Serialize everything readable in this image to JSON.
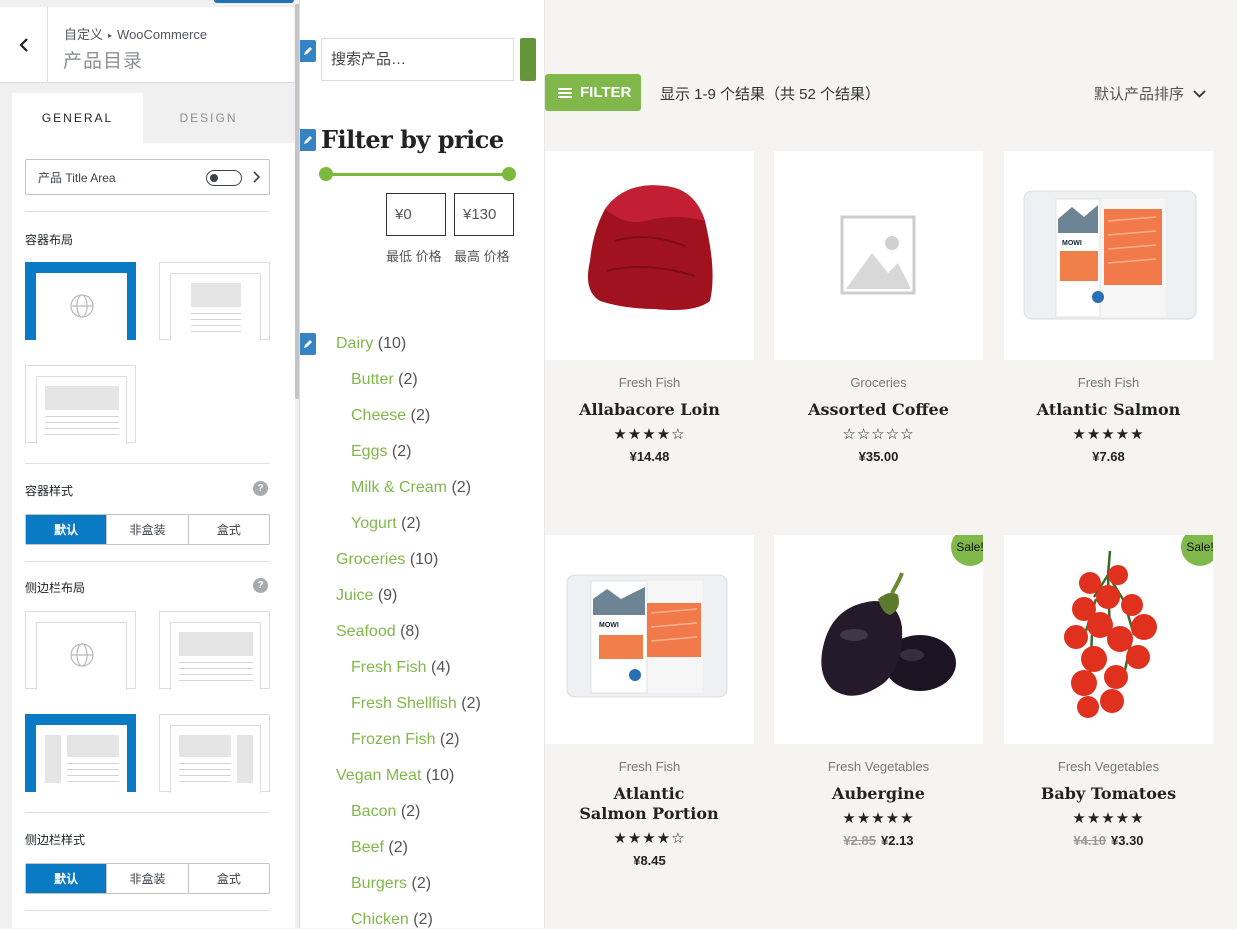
{
  "customizer": {
    "breadcrumb_root": "自定义",
    "breadcrumb_section": "WooCommerce",
    "title": "产品目录",
    "tabs": [
      "GENERAL",
      "DESIGN"
    ],
    "title_area_label": "产品 Title Area",
    "title_area_enabled": false,
    "container_layout_label": "容器布局",
    "container_style_label": "容器样式",
    "sidebar_layout_label": "侧边栏布局",
    "sidebar_style_label": "侧边栏样式",
    "help_icon": "?",
    "style_options": [
      "默认",
      "非盒装",
      "盒式"
    ],
    "container_style_selected": "默认",
    "sidebar_style_selected": "默认",
    "accent_color": "#0a7ac5"
  },
  "sidebar": {
    "search_placeholder": "搜索产品…",
    "filter_title": "Filter by price",
    "min_price": "¥0",
    "max_price": "¥130",
    "min_label": "最低 价格",
    "max_label": "最高 价格",
    "categories": [
      {
        "name": "Dairy",
        "count": "(10)",
        "level": 0
      },
      {
        "name": "Butter",
        "count": "(2)",
        "level": 1
      },
      {
        "name": "Cheese",
        "count": "(2)",
        "level": 1
      },
      {
        "name": "Eggs",
        "count": "(2)",
        "level": 1
      },
      {
        "name": "Milk & Cream",
        "count": "(2)",
        "level": 1
      },
      {
        "name": "Yogurt",
        "count": "(2)",
        "level": 1
      },
      {
        "name": "Groceries",
        "count": "(10)",
        "level": 0
      },
      {
        "name": "Juice",
        "count": "(9)",
        "level": 0
      },
      {
        "name": "Seafood",
        "count": "(8)",
        "level": 0
      },
      {
        "name": "Fresh Fish",
        "count": "(4)",
        "level": 1
      },
      {
        "name": "Fresh Shellfish",
        "count": "(2)",
        "level": 1
      },
      {
        "name": "Frozen Fish",
        "count": "(2)",
        "level": 1
      },
      {
        "name": "Vegan Meat",
        "count": "(10)",
        "level": 0
      },
      {
        "name": "Bacon",
        "count": "(2)",
        "level": 1
      },
      {
        "name": "Beef",
        "count": "(2)",
        "level": 1
      },
      {
        "name": "Burgers",
        "count": "(2)",
        "level": 1
      },
      {
        "name": "Chicken",
        "count": "(2)",
        "level": 1
      }
    ],
    "link_color": "#81b84b"
  },
  "shop": {
    "filter_label": "FILTER",
    "results_text": "显示 1-9 个结果（共 52 个结果）",
    "sort_label": "默认产品排序",
    "products": [
      {
        "category": "Fresh Fish",
        "name": "Allabacore Loin",
        "stars": "★★★★☆",
        "rating": 4,
        "old_price": "",
        "price": "¥14.48",
        "sale": false,
        "image": "tuna-loin"
      },
      {
        "category": "Groceries",
        "name": "Assorted Coffee",
        "stars": "☆☆☆☆☆",
        "rating": 0,
        "old_price": "",
        "price": "¥35.00",
        "sale": false,
        "image": "placeholder"
      },
      {
        "category": "Fresh Fish",
        "name": "Atlantic Salmon",
        "stars": "★★★★★",
        "rating": 5,
        "old_price": "",
        "price": "¥7.68",
        "sale": false,
        "image": "salmon-pack"
      },
      {
        "category": "Fresh Fish",
        "name": "Atlantic Salmon Portion",
        "stars": "★★★★☆",
        "rating": 4,
        "old_price": "",
        "price": "¥8.45",
        "sale": false,
        "image": "salmon-pack"
      },
      {
        "category": "Fresh Vegetables",
        "name": "Aubergine",
        "stars": "★★★★★",
        "rating": 5,
        "old_price": "¥2.85",
        "price": "¥2.13",
        "sale": true,
        "image": "aubergine"
      },
      {
        "category": "Fresh Vegetables",
        "name": "Baby Tomatoes",
        "stars": "★★★★★",
        "rating": 5,
        "old_price": "¥4.10",
        "price": "¥3.30",
        "sale": true,
        "image": "tomatoes"
      }
    ],
    "sale_label": "Sale!",
    "pack_brand": "MOWI",
    "accent_color": "#81b84b"
  }
}
